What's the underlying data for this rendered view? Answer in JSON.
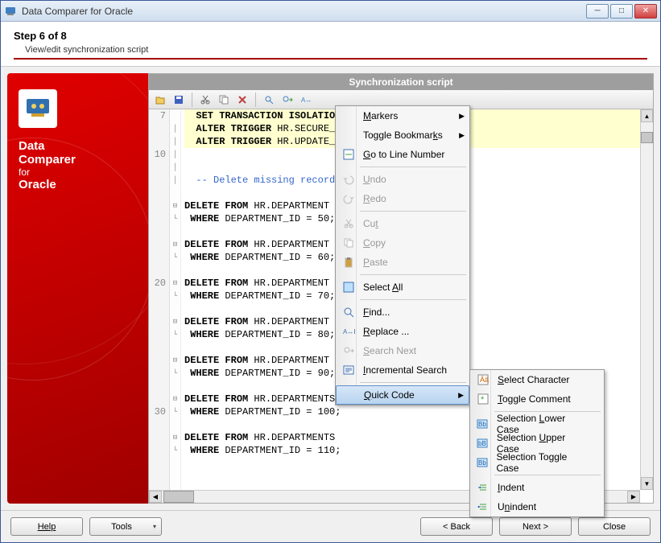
{
  "window": {
    "title": "Data Comparer for Oracle"
  },
  "step": {
    "title": "Step 6 of 8",
    "subtitle": "View/edit synchronization script"
  },
  "sidebar": {
    "brand_line1": "Data",
    "brand_line2": "Comparer",
    "brand_line3": "for",
    "brand_line4": "Oracle"
  },
  "panel": {
    "title": "Synchronization script"
  },
  "code": {
    "lines": [
      {
        "n": "7",
        "fold": "",
        "type": "hl",
        "text": "  SET TRANSACTION ISOLATION LEVEL READ COMMITTED;"
      },
      {
        "n": "",
        "fold": "│",
        "type": "hl",
        "text": "  ALTER TRIGGER HR.SECURE_E"
      },
      {
        "n": "",
        "fold": "│",
        "type": "hl",
        "text": "  ALTER TRIGGER HR.UPDATE_J"
      },
      {
        "n": "10",
        "fold": "│",
        "type": "",
        "text": ""
      },
      {
        "n": "",
        "fold": "│",
        "type": "",
        "text": ""
      },
      {
        "n": "",
        "fold": "│",
        "type": "cm",
        "text": "  -- Delete missing records"
      },
      {
        "n": "",
        "fold": "",
        "type": "",
        "text": ""
      },
      {
        "n": "",
        "fold": "⊟",
        "type": "",
        "text": "DELETE FROM HR.DEPARTMENT"
      },
      {
        "n": "",
        "fold": "└",
        "type": "",
        "text": " WHERE DEPARTMENT_ID = 50;"
      },
      {
        "n": "",
        "fold": "",
        "type": "",
        "text": ""
      },
      {
        "n": "",
        "fold": "⊟",
        "type": "",
        "text": "DELETE FROM HR.DEPARTMENT"
      },
      {
        "n": "",
        "fold": "└",
        "type": "",
        "text": " WHERE DEPARTMENT_ID = 60;"
      },
      {
        "n": "",
        "fold": "",
        "type": "",
        "text": ""
      },
      {
        "n": "20",
        "fold": "⊟",
        "type": "",
        "text": "DELETE FROM HR.DEPARTMENT"
      },
      {
        "n": "",
        "fold": "└",
        "type": "",
        "text": " WHERE DEPARTMENT_ID = 70;"
      },
      {
        "n": "",
        "fold": "",
        "type": "",
        "text": ""
      },
      {
        "n": "",
        "fold": "⊟",
        "type": "",
        "text": "DELETE FROM HR.DEPARTMENT"
      },
      {
        "n": "",
        "fold": "└",
        "type": "",
        "text": " WHERE DEPARTMENT_ID = 80;"
      },
      {
        "n": "",
        "fold": "",
        "type": "",
        "text": ""
      },
      {
        "n": "",
        "fold": "⊟",
        "type": "",
        "text": "DELETE FROM HR.DEPARTMENT"
      },
      {
        "n": "",
        "fold": "└",
        "type": "",
        "text": " WHERE DEPARTMENT_ID = 90;"
      },
      {
        "n": "",
        "fold": "",
        "type": "",
        "text": ""
      },
      {
        "n": "",
        "fold": "⊟",
        "type": "",
        "text": "DELETE FROM HR.DEPARTMENTS"
      },
      {
        "n": "30",
        "fold": "└",
        "type": "",
        "text": " WHERE DEPARTMENT_ID = 100;"
      },
      {
        "n": "",
        "fold": "",
        "type": "",
        "text": ""
      },
      {
        "n": "",
        "fold": "⊟",
        "type": "",
        "text": "DELETE FROM HR.DEPARTMENTS"
      },
      {
        "n": "",
        "fold": "└",
        "type": "",
        "text": " WHERE DEPARTMENT_ID = 110;"
      }
    ]
  },
  "context_menu": {
    "items": [
      {
        "label": "Markers",
        "arrow": true
      },
      {
        "label": "Toggle Bookmarks",
        "arrow": true
      },
      {
        "label": "Go to Line Number",
        "icon": "goto"
      },
      {
        "sep": true
      },
      {
        "label": "Undo",
        "icon": "undo",
        "disabled": true
      },
      {
        "label": "Redo",
        "icon": "redo",
        "disabled": true
      },
      {
        "sep": true
      },
      {
        "label": "Cut",
        "icon": "cut",
        "disabled": true
      },
      {
        "label": "Copy",
        "icon": "copy",
        "disabled": true
      },
      {
        "label": "Paste",
        "icon": "paste",
        "disabled": true
      },
      {
        "sep": true
      },
      {
        "label": "Select All",
        "icon": "selectall"
      },
      {
        "sep": true
      },
      {
        "label": "Find...",
        "icon": "find"
      },
      {
        "label": "Replace ...",
        "icon": "replace"
      },
      {
        "label": "Search Next",
        "icon": "searchnext",
        "disabled": true
      },
      {
        "label": "Incremental Search",
        "icon": "isearch"
      },
      {
        "sep": true
      },
      {
        "label": "Quick Code",
        "arrow": true,
        "highlighted": true
      }
    ]
  },
  "submenu": {
    "items": [
      {
        "label": "Select Character",
        "icon": "selchar"
      },
      {
        "label": "Toggle Comment",
        "icon": "togcom"
      },
      {
        "sep": true
      },
      {
        "label": "Selection Lower Case",
        "icon": "lower"
      },
      {
        "label": "Selection Upper Case",
        "icon": "upper"
      },
      {
        "label": "Selection Toggle Case",
        "icon": "togcase"
      },
      {
        "sep": true
      },
      {
        "label": "Indent",
        "icon": "indent"
      },
      {
        "label": "Unindent",
        "icon": "unindent"
      }
    ]
  },
  "footer": {
    "help": "Help",
    "tools": "Tools",
    "back": "< Back",
    "next": "Next >",
    "close": "Close"
  }
}
